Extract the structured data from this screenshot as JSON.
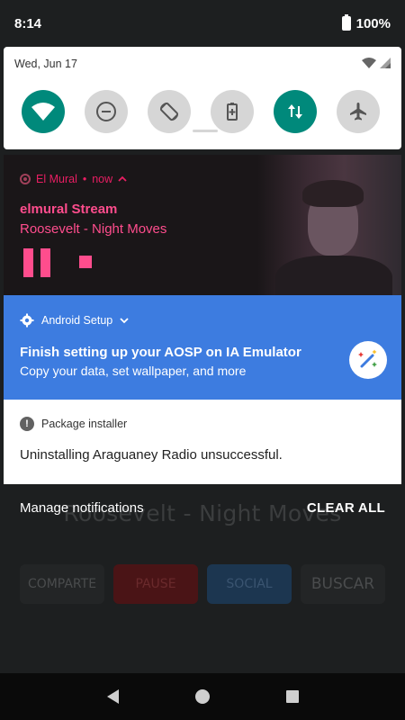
{
  "status_bar": {
    "time": "8:14",
    "battery": "100%"
  },
  "quick_settings": {
    "date": "Wed, Jun 17",
    "tiles": [
      {
        "name": "wifi",
        "state": "on"
      },
      {
        "name": "do-not-disturb",
        "state": "off"
      },
      {
        "name": "auto-rotate",
        "state": "off"
      },
      {
        "name": "battery-saver",
        "state": "off"
      },
      {
        "name": "mobile-data",
        "state": "on"
      },
      {
        "name": "airplane-mode",
        "state": "off"
      }
    ]
  },
  "media_notification": {
    "app_name": "El Mural",
    "time": "now",
    "title": "elmural Stream",
    "subtitle": "Roosevelt - Night Moves",
    "accent": "#ff4d8d"
  },
  "setup_notification": {
    "app_name": "Android Setup",
    "title": "Finish setting up your AOSP on IA Emulator",
    "text": "Copy your data, set wallpaper, and more",
    "background": "#3d7ce0"
  },
  "installer_notification": {
    "app_name": "Package installer",
    "text": "Uninstalling Araguaney Radio unsuccessful."
  },
  "footer": {
    "manage_label": "Manage notifications",
    "clear_label": "CLEAR ALL"
  },
  "background_app": {
    "song": "Roosevelt - Night Moves",
    "buttons": [
      "COMPARTE",
      "PAUSE",
      "SOCIAL",
      "BUSCAR"
    ]
  }
}
